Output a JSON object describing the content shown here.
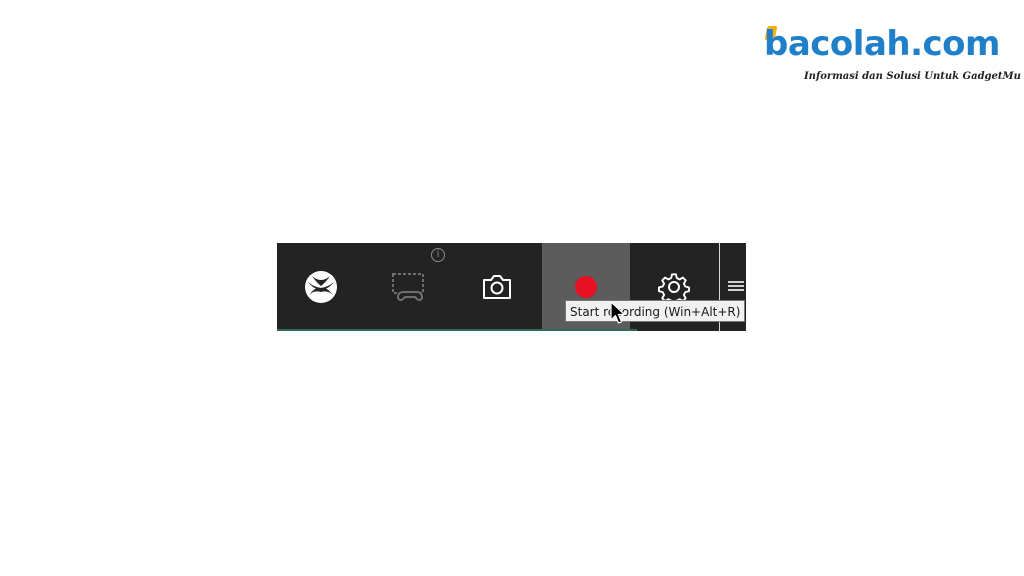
{
  "watermark": {
    "brand": "bacolah.com",
    "tagline": "Informasi dan Solusi Untuk GadgetMu"
  },
  "gamebar": {
    "buttons": [
      {
        "name": "xbox",
        "icon": "xbox-logo-icon"
      },
      {
        "name": "broadcast",
        "icon": "broadcast-gamepad-icon",
        "enabled": false
      },
      {
        "name": "screenshot",
        "icon": "camera-icon"
      },
      {
        "name": "record",
        "icon": "record-dot-icon",
        "color": "#e81123",
        "hovered": true
      },
      {
        "name": "settings",
        "icon": "gear-icon"
      }
    ],
    "info_glyph": "i",
    "colors": {
      "bar": "#232323",
      "hover": "#5c5c5c",
      "record": "#e81123",
      "accent_line": "#2f6a52"
    }
  },
  "tooltip": {
    "text": "Start recording (Win+Alt+R)"
  }
}
